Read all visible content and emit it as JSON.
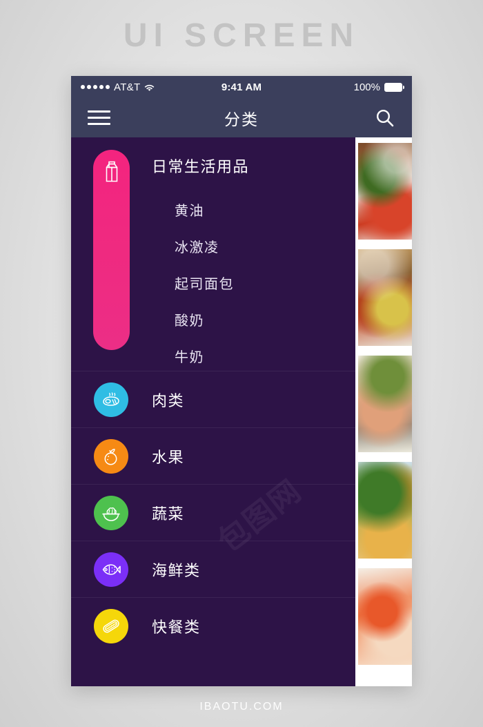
{
  "page": {
    "title": "UI SCREEN",
    "footer": "IBAOTU.COM",
    "watermark": "包图网"
  },
  "colors": {
    "navbar": "#3b3f5c",
    "sidebar": "#2d1347",
    "accent_pink": "#f4247f",
    "meat": "#2fbde4",
    "fruit": "#f68a14",
    "vegetable": "#4ec14e",
    "seafood": "#7b2ff7",
    "fastfood": "#f5d70a"
  },
  "statusbar": {
    "signal_dots": 5,
    "carrier": "AT&T",
    "wifi_icon": "wifi-icon",
    "time": "9:41 AM",
    "battery_percent": "100%",
    "battery_icon": "battery-full-icon"
  },
  "navbar": {
    "menu_icon": "hamburger-menu-icon",
    "title": "分类",
    "search_icon": "search-icon"
  },
  "categories": {
    "active": {
      "label": "日常生活用品",
      "icon": "milk-carton-icon",
      "color": "#f4247f",
      "subitems": [
        {
          "label": "黄油"
        },
        {
          "label": "冰激凌"
        },
        {
          "label": "起司面包"
        },
        {
          "label": "酸奶"
        },
        {
          "label": "牛奶"
        }
      ]
    },
    "items": [
      {
        "label": "肉类",
        "icon": "steak-icon",
        "color": "#2fbde4"
      },
      {
        "label": "水果",
        "icon": "orange-fruit-icon",
        "color": "#f68a14"
      },
      {
        "label": "蔬菜",
        "icon": "salad-bowl-icon",
        "color": "#4ec14e"
      },
      {
        "label": "海鲜类",
        "icon": "fish-icon",
        "color": "#7b2ff7"
      },
      {
        "label": "快餐类",
        "icon": "hotdog-icon",
        "color": "#f5d70a"
      }
    ]
  },
  "rail": {
    "cards": [
      {
        "name": "food-photo-steak-herbs",
        "c1": "#7a4a2a",
        "c2": "#d8442a",
        "c3": "#3f6b22"
      },
      {
        "name": "food-photo-grilled-meat",
        "c1": "#c9a36a",
        "c2": "#b4421d",
        "c3": "#d8c24a"
      },
      {
        "name": "food-photo-salmon-steak",
        "c1": "#e8e2d4",
        "c2": "#e0a07a",
        "c3": "#6f8f3a"
      },
      {
        "name": "food-photo-broccoli-fish",
        "c1": "#cfe0ea",
        "c2": "#3f7a28",
        "c3": "#e8b24a"
      },
      {
        "name": "food-photo-shrimp-platter",
        "c1": "#f2ece2",
        "c2": "#e8582a",
        "c3": "#f5d9c0"
      }
    ]
  }
}
